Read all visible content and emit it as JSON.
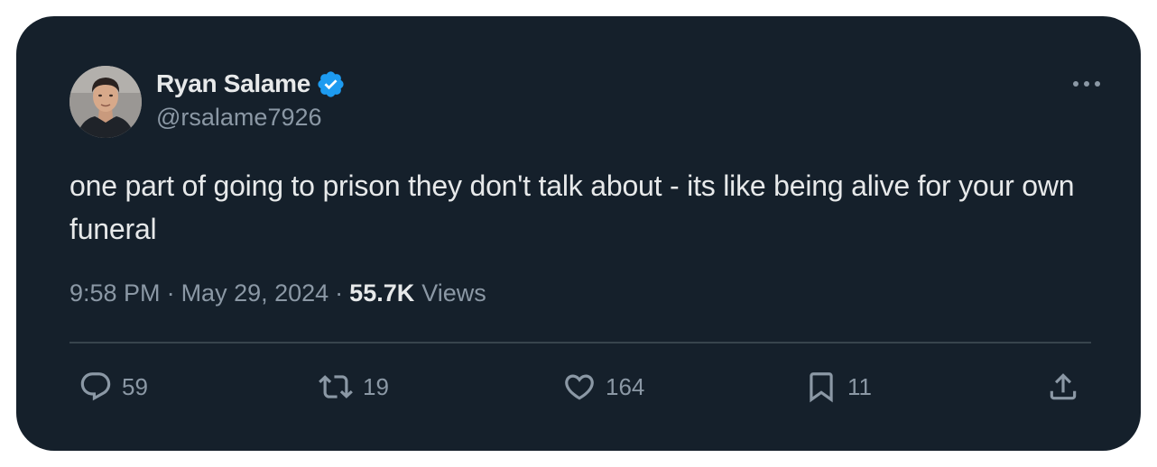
{
  "tweet": {
    "author": {
      "display_name": "Ryan Salame",
      "handle": "@rsalame7926",
      "verified": true,
      "verified_color": "#1d9bf0"
    },
    "text": "one part of going to prison they don't talk about - its like being alive for your own funeral",
    "time": "9:58 PM",
    "separator": "·",
    "date": "May 29, 2024",
    "views_count": "55.7K",
    "views_label": "Views"
  },
  "actions": {
    "replies": "59",
    "retweets": "19",
    "likes": "164",
    "bookmarks": "11"
  },
  "icons": {
    "more": "more-horizontal-icon",
    "reply": "reply-icon",
    "retweet": "retweet-icon",
    "like": "heart-icon",
    "bookmark": "bookmark-icon",
    "share": "share-icon"
  },
  "colors": {
    "background": "#15202b",
    "text": "#e7e9ea",
    "secondary_text": "#8b98a5",
    "divider": "#38444d",
    "accent": "#1d9bf0"
  }
}
